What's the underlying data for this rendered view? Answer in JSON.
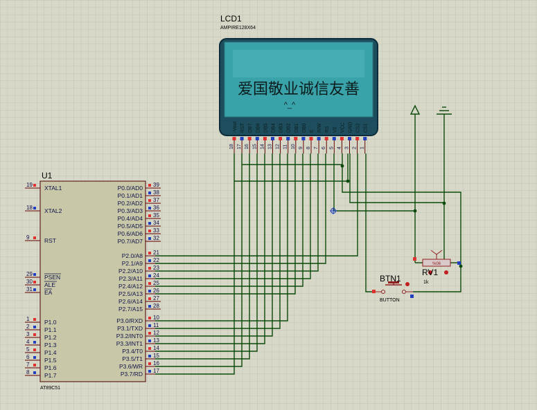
{
  "lcd": {
    "ref": "LCD1",
    "model": "AMPIRE128X64",
    "text": "爱国敬业诚信友善",
    "symbol": "^_^",
    "pins": [
      "-Vout",
      "RST",
      "DB7",
      "DB6",
      "DB5",
      "DB4",
      "DB3",
      "DB2",
      "DB1",
      "DB0",
      "E",
      "R/W",
      "RS",
      "V0",
      "VCC",
      "GND",
      "CS2",
      "CS1"
    ],
    "pin_numbers": [
      "18",
      "17",
      "16",
      "15",
      "14",
      "13",
      "12",
      "11",
      "10",
      "9",
      "8",
      "7",
      "6",
      "5",
      "4",
      "3",
      "2",
      "1"
    ]
  },
  "mcu": {
    "ref": "U1",
    "model": "AT89C51",
    "left_pins": [
      {
        "num": "19",
        "name": "XTAL1"
      },
      {
        "num": "18",
        "name": "XTAL2"
      },
      {
        "num": "9",
        "name": "RST"
      },
      {
        "num": "29",
        "name": "PSEN"
      },
      {
        "num": "30",
        "name": "ALE"
      },
      {
        "num": "31",
        "name": "EA"
      },
      {
        "num": "1",
        "name": "P1.0"
      },
      {
        "num": "2",
        "name": "P1.1"
      },
      {
        "num": "3",
        "name": "P1.2"
      },
      {
        "num": "4",
        "name": "P1.3"
      },
      {
        "num": "5",
        "name": "P1.4"
      },
      {
        "num": "6",
        "name": "P1.5"
      },
      {
        "num": "7",
        "name": "P1.6"
      },
      {
        "num": "8",
        "name": "P1.7"
      }
    ],
    "right_pins": [
      {
        "num": "39",
        "name": "P0.0/AD0"
      },
      {
        "num": "38",
        "name": "P0.1/AD1"
      },
      {
        "num": "37",
        "name": "P0.2/AD2"
      },
      {
        "num": "36",
        "name": "P0.3/AD3"
      },
      {
        "num": "35",
        "name": "P0.4/AD4"
      },
      {
        "num": "34",
        "name": "P0.5/AD5"
      },
      {
        "num": "33",
        "name": "P0.6/AD6"
      },
      {
        "num": "32",
        "name": "P0.7/AD7"
      },
      {
        "num": "21",
        "name": "P2.0/A8"
      },
      {
        "num": "22",
        "name": "P2.1/A9"
      },
      {
        "num": "23",
        "name": "P2.2/A10"
      },
      {
        "num": "24",
        "name": "P2.3/A11"
      },
      {
        "num": "25",
        "name": "P2.4/A12"
      },
      {
        "num": "26",
        "name": "P2.5/A13"
      },
      {
        "num": "27",
        "name": "P2.6/A14"
      },
      {
        "num": "28",
        "name": "P2.7/A15"
      },
      {
        "num": "10",
        "name": "P3.0/RXD"
      },
      {
        "num": "11",
        "name": "P3.1/TXD"
      },
      {
        "num": "12",
        "name": "P3.2/INT0"
      },
      {
        "num": "13",
        "name": "P3.3/INT1"
      },
      {
        "num": "14",
        "name": "P3.4/T0"
      },
      {
        "num": "15",
        "name": "P3.5/T1"
      },
      {
        "num": "16",
        "name": "P3.6/WR"
      },
      {
        "num": "17",
        "name": "P3.7/RD"
      }
    ]
  },
  "button": {
    "ref": "BTN1",
    "label": "BUTTON"
  },
  "pot": {
    "ref": "RV1",
    "value": "1k",
    "percent": "%06"
  },
  "colors": {
    "background": "#d8d8c8",
    "grid": "#c4c4b4",
    "wire": "#0a4a0a",
    "lcd_screen": "#3aa3aa",
    "chip_body": "#c8c8a8"
  }
}
